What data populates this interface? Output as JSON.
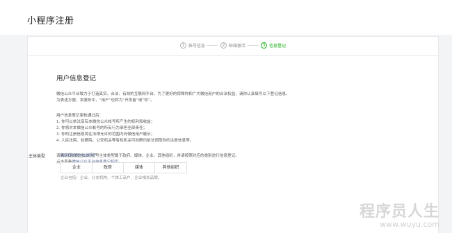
{
  "header": {
    "title": "小程序注册"
  },
  "steps": [
    {
      "num": "1",
      "label": "帐号信息",
      "active": false
    },
    {
      "num": "2",
      "label": "邮箱激活",
      "active": false
    },
    {
      "num": "3",
      "label": "信息登记",
      "active": true
    }
  ],
  "main": {
    "section_title": "用户信息登记",
    "intro": [
      "微信公众平台致力于打造真实、合法、有效的互联网平台。为了更好的保障你和广大微信用户的合法权益，请你认真填写以下登记信息。",
      "为表述方便，本服务中，“用户”也称为“开发者”或“你”。"
    ],
    "rules": [
      "用户信息登记审核通过后：",
      "1. 你可以依法享有本微信公众帐号所产生的权利和收益；",
      "2. 你将对本微信公众帐号的所有行为承担全部责任；",
      "3. 你的注册信息将在法律允许的范围内向微信用户展示；",
      "4. 人民法院、检察院、公安机关等有权机关可向腾讯依法调取你的注册信息等。"
    ],
    "confirm_line": "请确认你的微信公众帐号主体类型属于政府、媒体、企业、其他组织，并请按照对应的类别进行信息登记。",
    "guide_prefix": "点击查看",
    "guide_link": "微信公众平台信息登记指引",
    "guide_suffix": "。"
  },
  "entity": {
    "label": "主体类型",
    "help_link": "如何选择主体类型？",
    "options": [
      "企业",
      "政府",
      "媒体",
      "其他组织"
    ],
    "note": "企业包括：企业、分支机构、个体工商户、企业相关品牌。"
  },
  "watermark": {
    "title": "程序员人生",
    "url": "www.wuyu.com"
  },
  "colors": {
    "active": "#1aad19",
    "link": "#576b95"
  }
}
